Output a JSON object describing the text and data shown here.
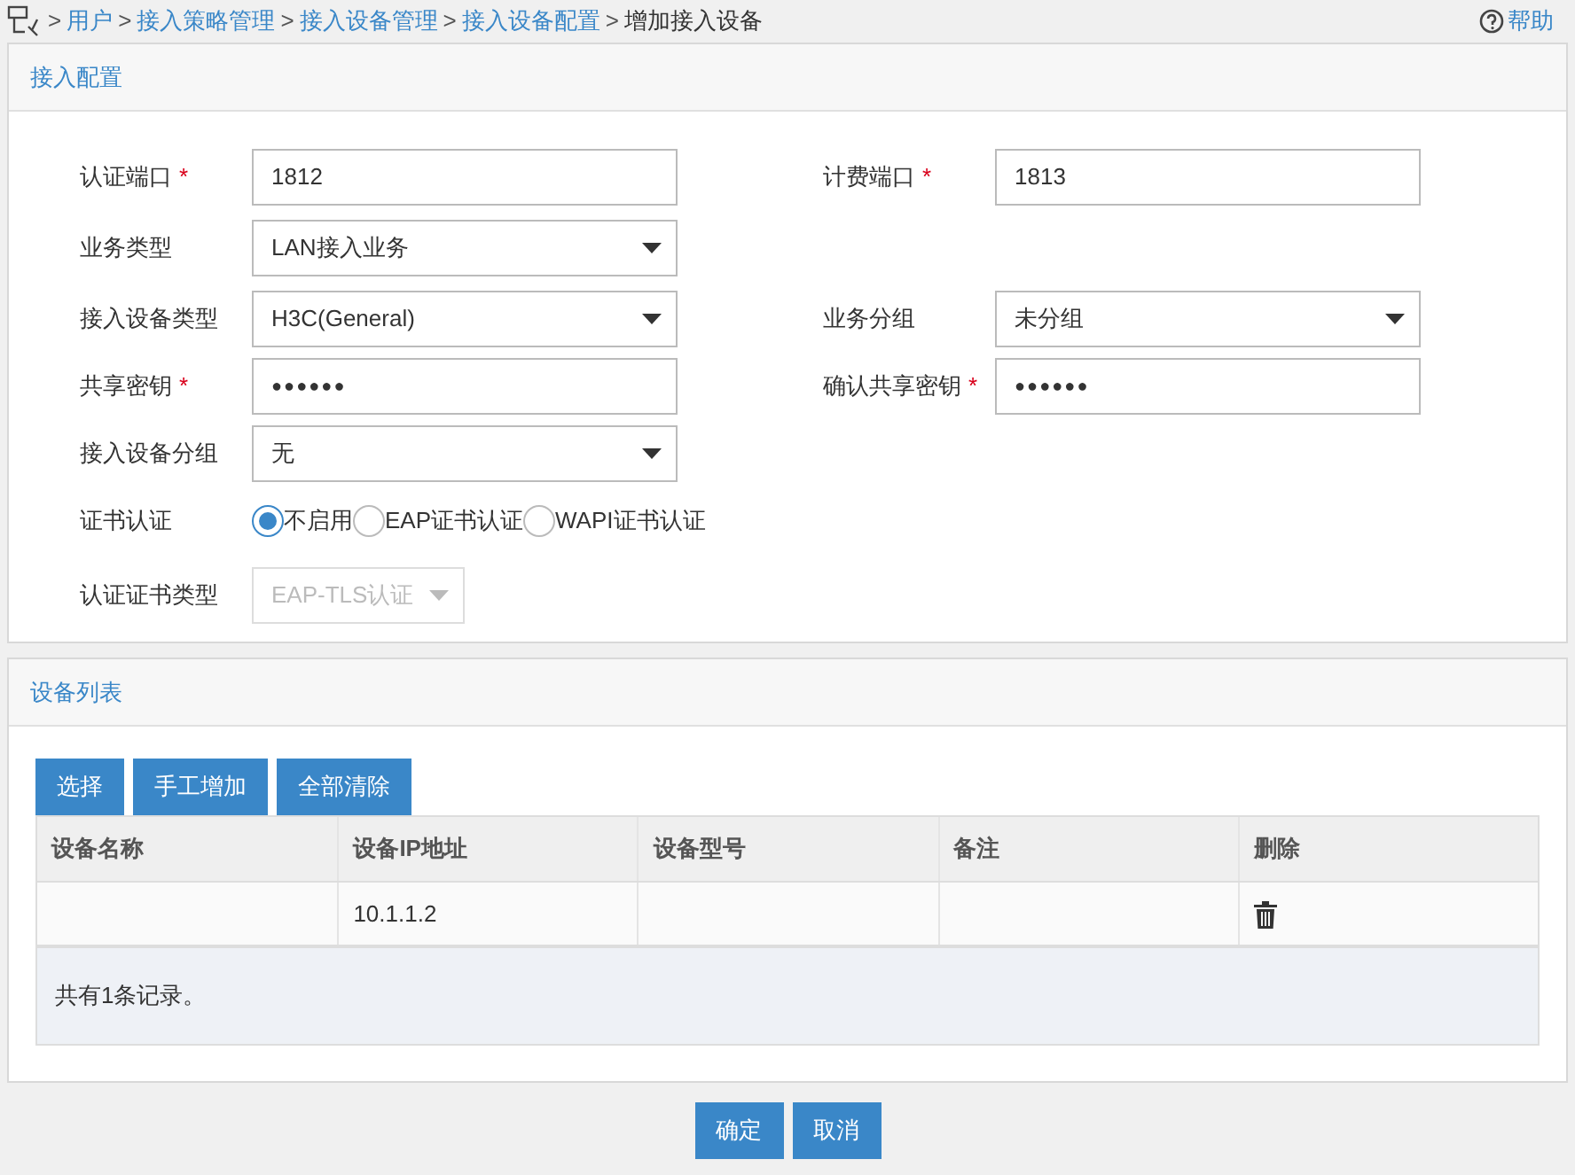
{
  "breadcrumb": {
    "links": [
      "用户",
      "接入策略管理",
      "接入设备管理",
      "接入设备配置"
    ],
    "separator": ">",
    "current": "增加接入设备"
  },
  "help": "帮助",
  "access_config": {
    "title": "接入配置",
    "rows": [
      {
        "fields": [
          {
            "kind": "text",
            "label": "认证端口",
            "required_mark": "*",
            "value": "1812"
          },
          {
            "kind": "text",
            "label": "计费端口",
            "required_mark": "*",
            "value": "1813"
          }
        ]
      },
      {
        "fields": [
          {
            "kind": "select",
            "label": "业务类型",
            "value": "LAN接入业务"
          }
        ]
      },
      {
        "fields": [
          {
            "kind": "select",
            "label": "接入设备类型",
            "value": "H3C(General)"
          },
          {
            "kind": "select",
            "label": "业务分组",
            "value": "未分组"
          }
        ]
      },
      {
        "fields": [
          {
            "kind": "password",
            "label": "共享密钥",
            "required_mark": "*",
            "value": "●●●●●●"
          },
          {
            "kind": "password",
            "label": "确认共享密钥",
            "required_mark": "*",
            "value": "●●●●●●"
          }
        ]
      },
      {
        "fields": [
          {
            "kind": "select",
            "label": "接入设备分组",
            "value": "无"
          }
        ]
      },
      {
        "fields": [
          {
            "kind": "radio",
            "label": "证书认证",
            "options": [
              {
                "label": "不启用",
                "selected": true
              },
              {
                "label": "EAP证书认证",
                "selected": false
              },
              {
                "label": "WAPI证书认证",
                "selected": false
              }
            ]
          }
        ]
      },
      {
        "fields": [
          {
            "kind": "small_select",
            "label": "认证证书类型",
            "value": "EAP-TLS认证",
            "disabled": true
          }
        ]
      }
    ]
  },
  "device_list": {
    "title": "设备列表",
    "buttons": [
      "选择",
      "手工增加",
      "全部清除"
    ],
    "columns": [
      "设备名称",
      "设备IP地址",
      "设备型号",
      "备注",
      "删除"
    ],
    "rows": [
      {
        "ip": "10.1.1.2",
        "deletable": true
      }
    ],
    "summary": "共有1条记录。"
  },
  "footer_buttons": [
    "确定",
    "取消"
  ]
}
